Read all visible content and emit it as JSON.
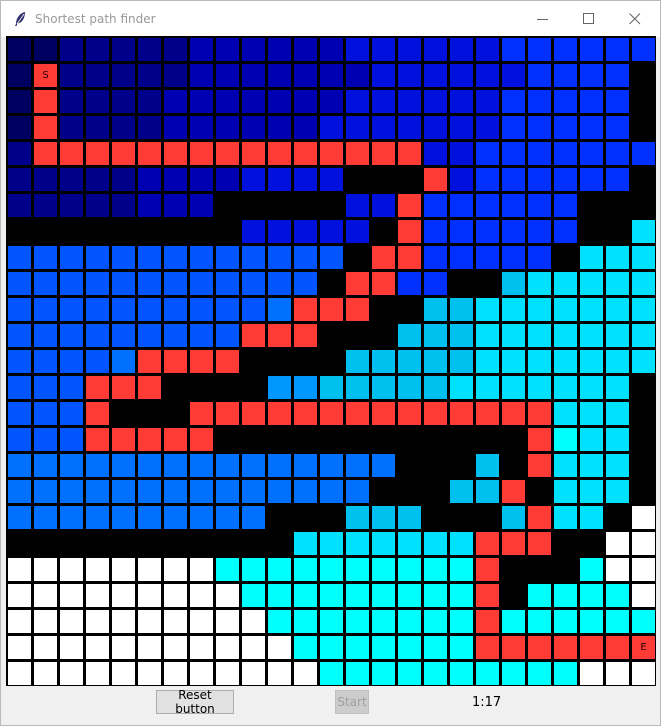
{
  "window": {
    "title": "Shortest path finder",
    "app_icon": "feather-icon",
    "controls": [
      "minimize-icon",
      "maximize-icon",
      "close-icon"
    ]
  },
  "grid": {
    "rows": 25,
    "cols": 25,
    "start_label": "S",
    "end_label": "E",
    "palette": {
      "W": "#000000",
      "P": "#ff3b35",
      "S": "#ff3b35",
      "E": "#ff3b35",
      "O": "#ffffff",
      "0": "#000060",
      "1": "#00008a",
      "2": "#0000b3",
      "3": "#0010dd",
      "4": "#0030ff",
      "5": "#0055ff",
      "6": "#0070ff",
      "7": "#0098ff",
      "8": "#00c0f0",
      "9": "#00e0ff",
      "A": "#00ffff"
    },
    "cells": [
      "0011111222222333333444444",
      "0S1111122222223333334444W",
      "0P1111222222233333344444W",
      "0P1111222222333333344444W",
      "1PPPPPPPPPPPPPPP334444444",
      "1111122223333WWWP3444444W",
      "11111222WWWWW33P444444WWW",
      "WWWWWWWWW33333WP444444WW9",
      "5555555555555WPP44444W999",
      "555555555555WPP44WW899999",
      "55555555556PPPWW889999999",
      "555555555PPPWWW8889999999",
      "55556PPPPWWWW888889999999",
      "555PPPWWWW77888889999999W",
      "555PWWWPPPPPPPPPPPPPP999W",
      "555PPPPPWWWWWWWWWWWWPA99W",
      "666666666666666WWW8WP999W",
      "66666666666666WWW88PW999W",
      "6666666666WWW888WWW8P99WO",
      "WWWWWWWWWWW9999999PPPWWOO",
      "OOOOOOOOAAAAAAAAAAPWWWAOO",
      "OOOOOOOOOAAAAAAAAAPWAAAAO",
      "OOOOOOOOOOAAAAAAAAPAAAAAA",
      "OOOOOOOOOOOAAAAAAAPPPPPPE",
      "OOOOOOOOOOOOAAAAAAAAAAOOO"
    ]
  },
  "controls": {
    "reset_label": "Reset button",
    "start_label": "Start",
    "timer": "1:17"
  }
}
